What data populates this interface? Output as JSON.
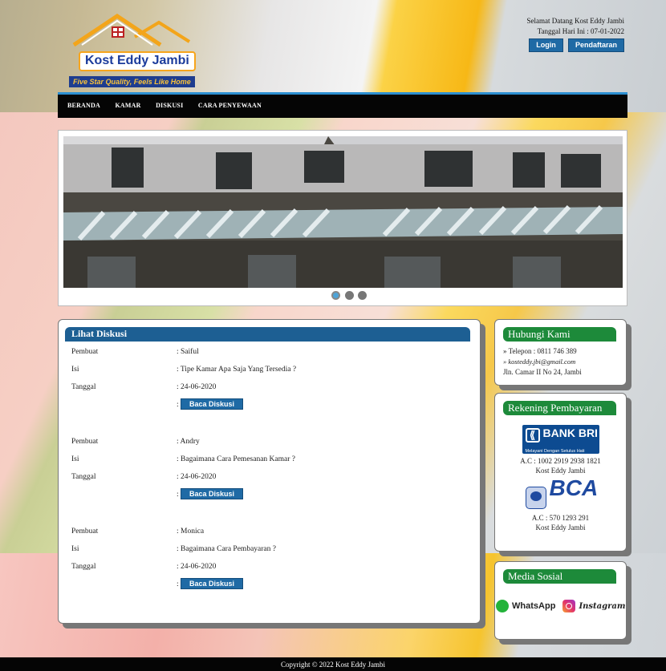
{
  "header": {
    "brand": "Kost Eddy Jambi",
    "tagline": "Five Star Quality, Feels Like Home",
    "welcome": "Selamat Datang Kost Eddy Jambi",
    "date_text": "Tanggal Hari Ini : 07-01-2022",
    "login_label": "Login",
    "register_label": "Pendaftaran"
  },
  "nav": {
    "items": [
      "BERANDA",
      "KAMAR",
      "DISKUSI",
      "CARA PENYEWAAN"
    ]
  },
  "slider": {
    "dots_count": 3,
    "active_index": 0
  },
  "main": {
    "title": "Lihat Diskusi",
    "labels": {
      "author": "Pembuat",
      "content": "Isi",
      "date": "Tanggal",
      "read_button": "Baca Diskusi"
    },
    "discussions": [
      {
        "author": ": Saiful",
        "content": ": Tipe Kamar Apa Saja Yang Tersedia ?",
        "date": ": 24-06-2020"
      },
      {
        "author": ": Andry",
        "content": ": Bagaimana Cara Pemesanan Kamar ?",
        "date": ": 24-06-2020"
      },
      {
        "author": ": Monica",
        "content": ": Bagaimana Cara Pembayaran ?",
        "date": ": 24-06-2020"
      }
    ]
  },
  "contact": {
    "title": "Hubungi Kami",
    "phone": "» Telepon : 0811 746 389",
    "email": "» kosteddy.jbi@gmail.com",
    "address": "Jln. Camar II No 24, Jambi"
  },
  "payment": {
    "title": "Rekening Pembayaran",
    "banks": [
      {
        "logo_text": "BANK BRI",
        "logo_sub": "Melayani Dengan Setulus Hati",
        "account": "A.C : 1002 2919 2938 1821",
        "holder": "Kost Eddy Jambi"
      },
      {
        "logo_text": "BCA",
        "account": "A.C : 570 1293 291",
        "holder": "Kost Eddy Jambi"
      }
    ]
  },
  "social": {
    "title": "Media Sosial",
    "whatsapp": "WhatsApp",
    "instagram": "Instagram"
  },
  "footer": {
    "copyright": "Copyright © 2022 Kost Eddy Jambi"
  },
  "colors": {
    "nav_bg": "#050505",
    "nav_accent": "#2c8fd1",
    "title_blue": "#1d5f93",
    "button_blue": "#1f6aa5",
    "side_green": "#1d8a3a"
  }
}
